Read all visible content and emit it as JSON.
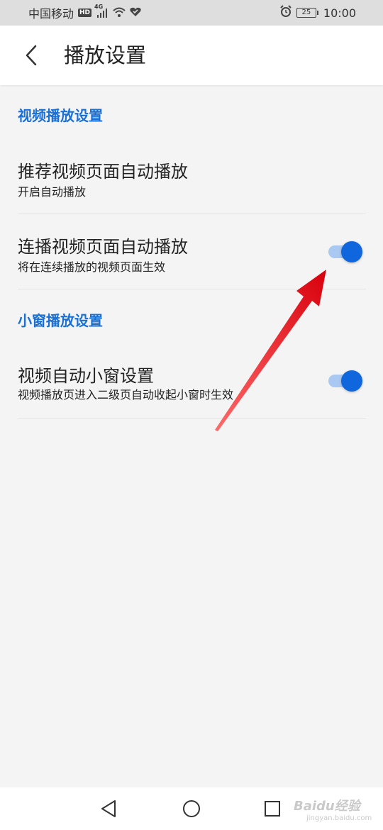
{
  "status_bar": {
    "carrier": "中国移动",
    "hd": "HD",
    "network": "4G",
    "battery": "25",
    "time": "10:00"
  },
  "header": {
    "title": "播放设置"
  },
  "sections": [
    {
      "title": "视频播放设置",
      "items": [
        {
          "title": "推荐视频页面自动播放",
          "subtitle": "开启自动播放",
          "has_toggle": false
        },
        {
          "title": "连播视频页面自动播放",
          "subtitle": "将在连续播放的视频页面生效",
          "has_toggle": true,
          "toggle_on": true
        }
      ]
    },
    {
      "title": "小窗播放设置",
      "items": [
        {
          "title": "视频自动小窗设置",
          "subtitle": "视频播放页进入二级页自动收起小窗时生效",
          "has_toggle": true,
          "toggle_on": true
        }
      ]
    }
  ],
  "watermark": {
    "text": "Baidu经验",
    "sub": "jingyan.baidu.com"
  },
  "colors": {
    "accent": "#1a6fd4",
    "toggle_on": "#1067dd",
    "arrow": "#e8141c"
  },
  "icons": {
    "back": "chevron-left-icon",
    "nav_back": "triangle-back-icon",
    "nav_home": "circle-home-icon",
    "nav_recent": "square-recent-icon"
  }
}
